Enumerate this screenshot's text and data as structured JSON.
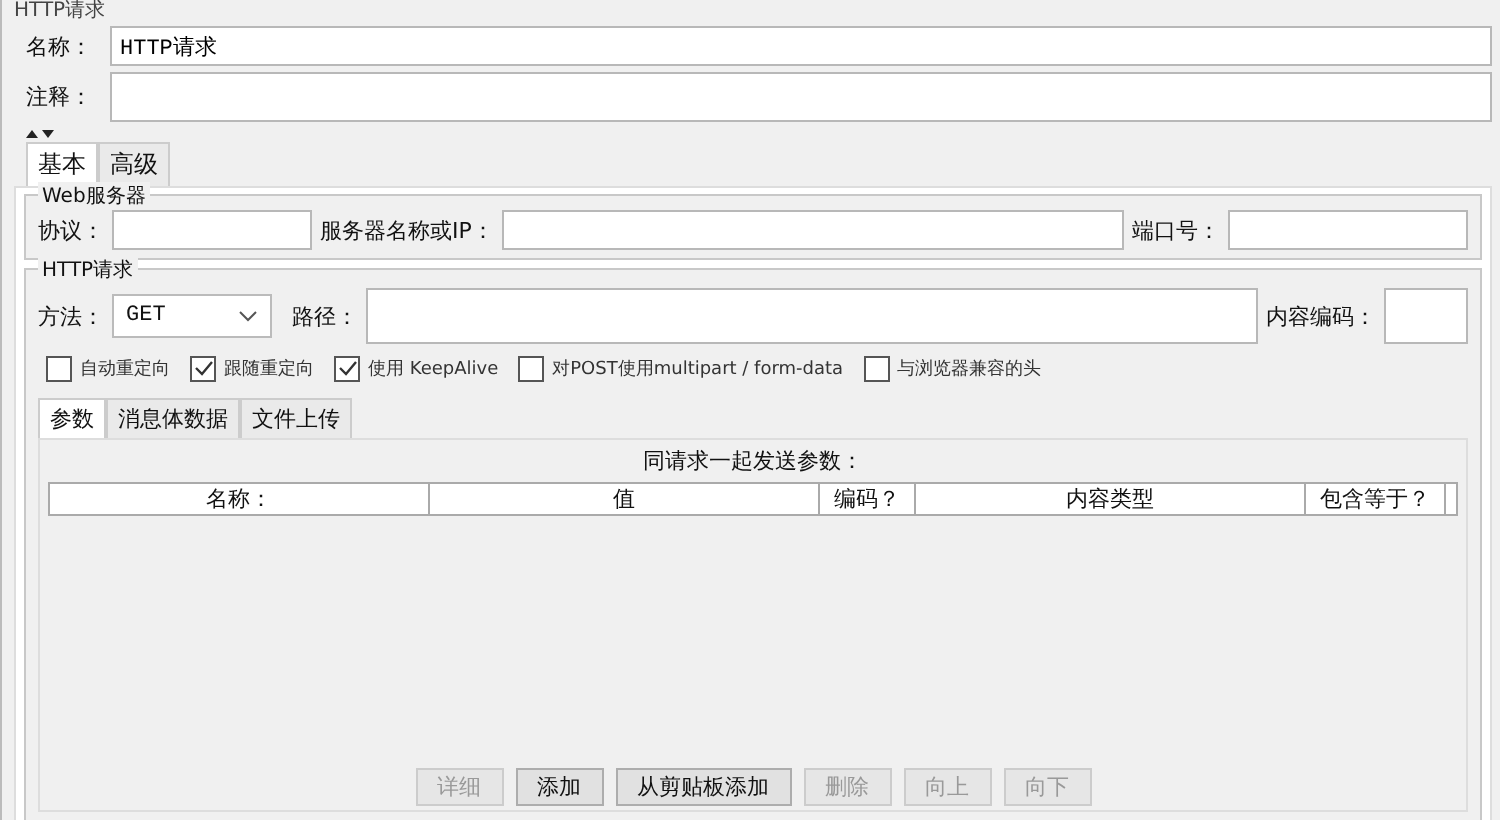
{
  "title": "HTTP请求",
  "name": {
    "label": "名称：",
    "value": "HTTP请求"
  },
  "comment": {
    "label": "注释："
  },
  "tabs": [
    {
      "label": "基本",
      "selected": true
    },
    {
      "label": "高级",
      "selected": false
    }
  ],
  "web_server": {
    "legend": "Web服务器",
    "protocol_label": "协议：",
    "server_label": "服务器名称或IP：",
    "port_label": "端口号："
  },
  "http_request": {
    "legend": "HTTP请求",
    "method_label": "方法：",
    "method": "GET",
    "path_label": "路径：",
    "encoding_label": "内容编码：",
    "options": [
      {
        "label": "自动重定向",
        "checked": false
      },
      {
        "label": "跟随重定向",
        "checked": true
      },
      {
        "label": "使用 KeepAlive",
        "checked": true
      },
      {
        "label": "对POST使用multipart / form-data",
        "checked": false
      },
      {
        "label": "与浏览器兼容的头",
        "checked": false
      }
    ],
    "sub_tabs": [
      {
        "label": "参数",
        "selected": true
      },
      {
        "label": "消息体数据",
        "selected": false
      },
      {
        "label": "文件上传",
        "selected": false
      }
    ],
    "table_caption": "同请求一起发送参数：",
    "columns": [
      "名称：",
      "值",
      "编码？",
      "内容类型",
      "包含等于？"
    ],
    "buttons": [
      {
        "label": "详细",
        "disabled": true
      },
      {
        "label": "添加",
        "disabled": false
      },
      {
        "label": "从剪贴板添加",
        "disabled": false
      },
      {
        "label": "删除",
        "disabled": true
      },
      {
        "label": "向上",
        "disabled": true
      },
      {
        "label": "向下",
        "disabled": true
      }
    ]
  }
}
